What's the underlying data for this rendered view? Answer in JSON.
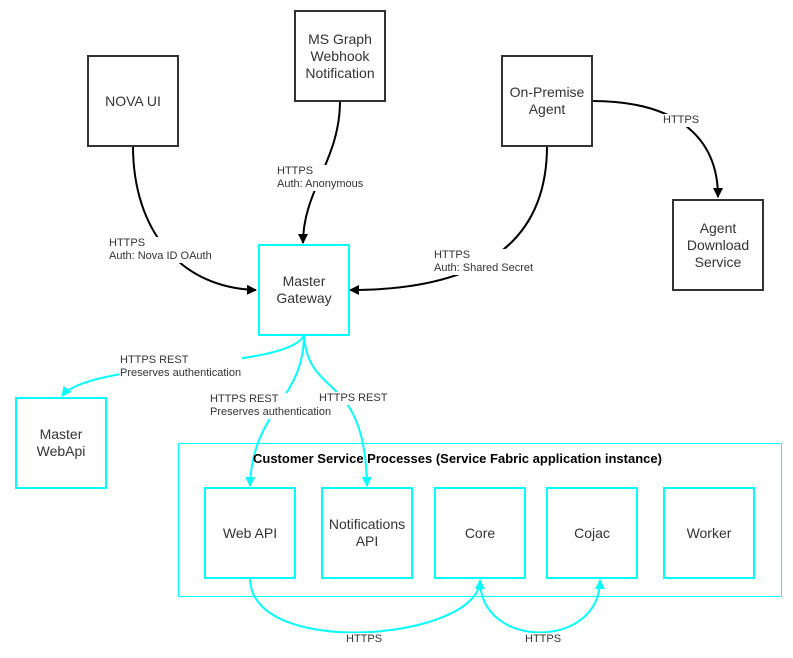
{
  "colors": {
    "external": "#333333",
    "internal": "#00ffff",
    "text": "#333333"
  },
  "nodes": {
    "nova_ui": "NOVA UI",
    "ms_graph": "MS Graph\nWebhook\nNotification",
    "on_premise_agent": "On-Premise\nAgent",
    "agent_download_service": "Agent\nDownload\nService",
    "master_gateway": "Master\nGateway",
    "master_webapi": "Master\nWebApi",
    "web_api": "Web API",
    "notifications_api": "Notifications\nAPI",
    "core": "Core",
    "cojac": "Cojac",
    "worker": "Worker"
  },
  "container": {
    "title": "Customer Service Processes (Service Fabric application instance)"
  },
  "edges": {
    "nova_to_gateway": "HTTPS\nAuth: Nova ID OAuth",
    "msgraph_to_gateway": "HTTPS\nAuth: Anonymous",
    "agent_to_gateway": "HTTPS\nAuth: Shared Secret",
    "agent_to_download": "HTTPS",
    "gateway_to_master_webapi": "HTTPS REST\nPreserves authentication",
    "gateway_to_web_api": "HTTPS REST\nPreserves authentication",
    "gateway_to_notifications": "HTTPS REST",
    "webapi_to_core": "HTTPS",
    "core_to_cojac": "HTTPS"
  }
}
